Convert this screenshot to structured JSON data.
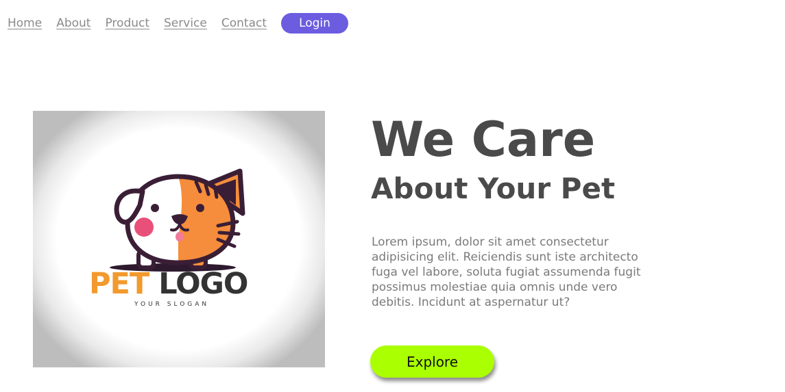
{
  "nav": {
    "items": [
      {
        "label": "Home"
      },
      {
        "label": "About"
      },
      {
        "label": "Product"
      },
      {
        "label": "Service"
      },
      {
        "label": "Contact"
      }
    ],
    "login_label": "Login"
  },
  "hero": {
    "logo": {
      "word1": "PET",
      "word2": "LOGO",
      "slogan": "YOUR SLOGAN",
      "icon": "dog-cat-face-icon"
    },
    "headline_line1": "We Care",
    "headline_line2": "About Your Pet",
    "description": "Lorem ipsum, dolor sit amet consectetur adipisicing elit. Reiciendis sunt iste architecto fuga vel labore, soluta fugiat assumenda fugit possimus molestiae quia omnis unde vero debitis. Incidunt at aspernatur ut?",
    "explore_label": "Explore"
  },
  "colors": {
    "login_bg": "#6b5ce0",
    "explore_bg": "#aaff00",
    "heading": "#4a4a4a",
    "logo_orange": "#f29a2e"
  }
}
